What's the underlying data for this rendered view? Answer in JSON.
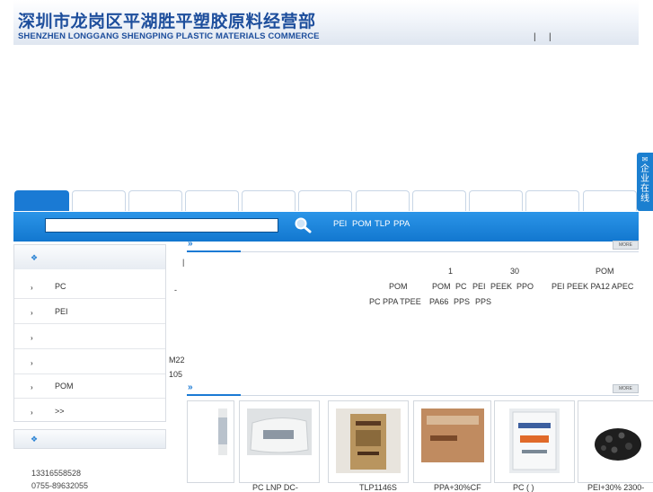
{
  "header": {
    "title_cn": "深圳市龙岗区平湖胜平塑胶原料经营部",
    "title_en": "SHENZHEN LONGGANG SHENGPING PLASTIC MATERIALS COMMERCE",
    "separators": [
      "|",
      "|"
    ]
  },
  "float_service": {
    "label": "企业在线"
  },
  "nav": {
    "tab_count": 11,
    "active_index": 0
  },
  "search": {
    "value": "",
    "placeholder": "",
    "hot_keywords": [
      "PEI",
      "POM",
      "TLP",
      "PPA"
    ]
  },
  "left": {
    "categories": [
      {
        "label": "PC"
      },
      {
        "label": "PEI"
      },
      {
        "label": ""
      },
      {
        "label": ""
      },
      {
        "label": "POM"
      },
      {
        "label": ">>"
      }
    ],
    "contact": {
      "phone": "13316558528",
      "tel": "0755-89632055"
    }
  },
  "intro": {
    "cursor": "|",
    "dash": "-",
    "line1": {
      "num1": "1",
      "num2": "30",
      "kw": "POM"
    },
    "line2": {
      "a": "POM",
      "b": "POM",
      "c": "PC",
      "d": "PEI",
      "e": "PEEK",
      "f": "PPO",
      "g": "PEI PEEK PA12 APEC"
    },
    "line3": {
      "a": "PC PPA TPEE",
      "b": "PA66",
      "c": "PPS",
      "d": "PPS"
    },
    "m22": "M22",
    "n105": "105"
  },
  "more_label": "MORE",
  "products": [
    {
      "caption": ""
    },
    {
      "caption": "PC    LNP DC-"
    },
    {
      "caption": "TLP1146S"
    },
    {
      "caption": "PPA+30%CF"
    },
    {
      "caption": "PC    (    )"
    },
    {
      "caption": "PEI+30%  2300-"
    }
  ]
}
